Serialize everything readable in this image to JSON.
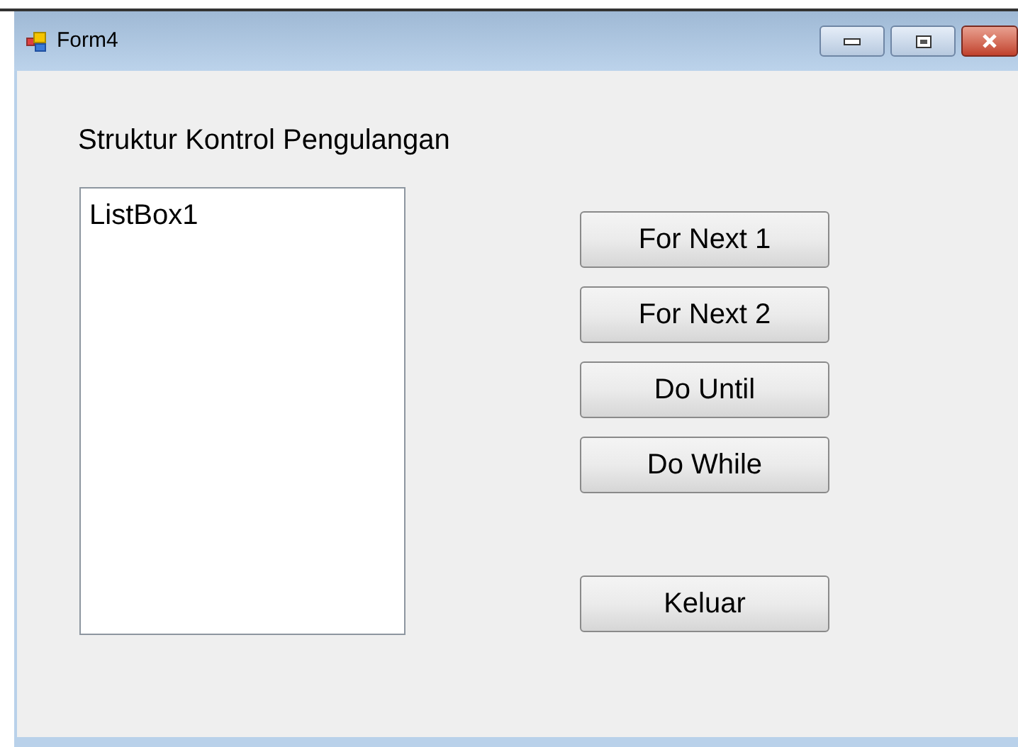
{
  "window": {
    "title": "Form4"
  },
  "label": "Struktur Kontrol Pengulangan",
  "listbox": {
    "items": [
      "ListBox1"
    ]
  },
  "buttons": [
    "For Next 1",
    "For Next 2",
    "Do Until",
    "Do While"
  ],
  "exit_button": "Keluar"
}
